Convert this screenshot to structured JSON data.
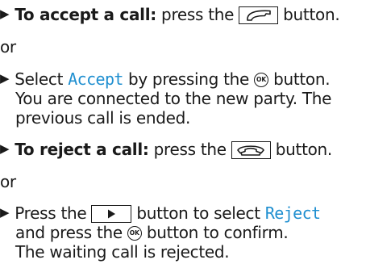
{
  "bullet": "▶",
  "accent_color": "#1f8fd0",
  "accept_call": {
    "lead": "To accept a call:",
    "text_before": "press the",
    "key_icon": "phone-accept-key-icon",
    "text_after": "button."
  },
  "or_1": "or",
  "select_accept": {
    "before": "Select",
    "option": "Accept",
    "middle": "by pressing the",
    "ok_label": "OK",
    "after": "button.",
    "line2": "You are connected to the new party. The",
    "line3": "previous call is ended."
  },
  "reject_call": {
    "lead": "To reject a call:",
    "text_before": "press the",
    "key_icon": "phone-hangup-key-icon",
    "text_after": "button."
  },
  "or_2": "or",
  "select_reject": {
    "before": "Press the",
    "arrow_icon": "right-arrow-key-icon",
    "middle": "button to select",
    "option": "Reject",
    "line2_before": "and press the",
    "ok_label": "OK",
    "line2_after": "button to confirm.",
    "line3": "The waiting call is rejected."
  }
}
